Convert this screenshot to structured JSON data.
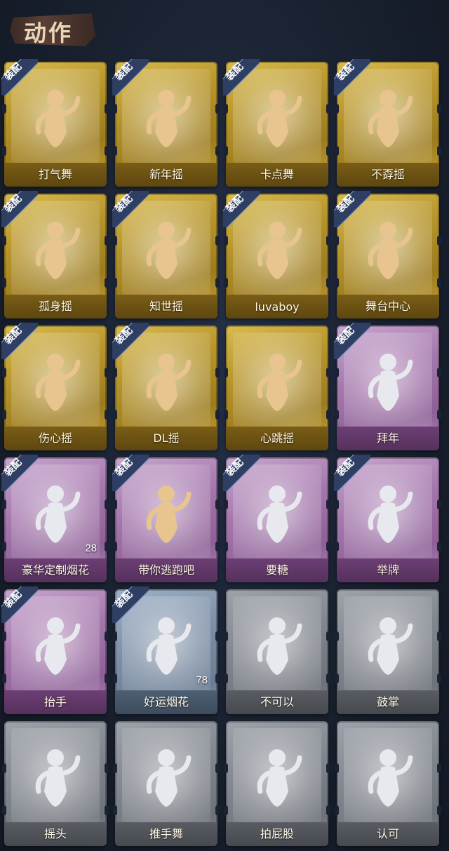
{
  "header": {
    "title": "动作"
  },
  "equip_label": "装配",
  "colors": {
    "gold": "#c9a73a",
    "purple": "#a578ad",
    "blue": "#7c8ea6",
    "gray": "#80858d",
    "figure_gold": "#e8c48f",
    "figure_white": "#e7e9ee"
  },
  "cards": [
    {
      "label": "打气舞",
      "tier": "gold",
      "equipped": true,
      "icon": "dance-pump-icon"
    },
    {
      "label": "新年摇",
      "tier": "gold",
      "equipped": true,
      "icon": "dance-newyear-icon"
    },
    {
      "label": "卡点舞",
      "tier": "gold",
      "equipped": true,
      "icon": "dance-beat-icon"
    },
    {
      "label": "不孬摇",
      "tier": "gold",
      "equipped": true,
      "icon": "dance-sway-icon"
    },
    {
      "label": "孤身摇",
      "tier": "gold",
      "equipped": true,
      "icon": "dance-solo-icon"
    },
    {
      "label": "知世摇",
      "tier": "gold",
      "equipped": true,
      "icon": "dance-wisdom-icon"
    },
    {
      "label": "luvaboy",
      "tier": "gold",
      "equipped": true,
      "icon": "dance-luvaboy-icon"
    },
    {
      "label": "舞台中心",
      "tier": "gold",
      "equipped": true,
      "icon": "dance-center-icon"
    },
    {
      "label": "伤心摇",
      "tier": "gold",
      "equipped": true,
      "icon": "heart-hands-icon"
    },
    {
      "label": "DL摇",
      "tier": "gold",
      "equipped": true,
      "icon": "dance-dl-icon"
    },
    {
      "label": "心跳摇",
      "tier": "gold",
      "equipped": false,
      "icon": "dance-heartbeat-icon"
    },
    {
      "label": "拜年",
      "tier": "purple",
      "equipped": true,
      "icon": "bow-greeting-icon"
    },
    {
      "label": "豪华定制烟花",
      "tier": "purple",
      "equipped": true,
      "icon": "fireworks-box-icon",
      "count": "28"
    },
    {
      "label": "带你逃跑吧",
      "tier": "purple",
      "equipped": true,
      "icon": "dance-run-icon"
    },
    {
      "label": "要糖",
      "tier": "purple",
      "equipped": true,
      "icon": "ask-candy-icon"
    },
    {
      "label": "举牌",
      "tier": "purple",
      "equipped": true,
      "icon": "hold-sign-icon"
    },
    {
      "label": "抬手",
      "tier": "purple",
      "equipped": true,
      "icon": "raise-hand-icon"
    },
    {
      "label": "好运烟花",
      "tier": "blue",
      "equipped": true,
      "icon": "firework-can-icon",
      "count": "78"
    },
    {
      "label": "不可以",
      "tier": "gray",
      "equipped": false,
      "icon": "finger-wag-icon"
    },
    {
      "label": "鼓掌",
      "tier": "gray",
      "equipped": false,
      "icon": "clap-icon"
    },
    {
      "label": "摇头",
      "tier": "gray",
      "equipped": false,
      "icon": "shake-head-icon"
    },
    {
      "label": "推手舞",
      "tier": "gray",
      "equipped": false,
      "icon": "push-dance-icon"
    },
    {
      "label": "拍屁股",
      "tier": "gray",
      "equipped": false,
      "icon": "pat-butt-icon"
    },
    {
      "label": "认可",
      "tier": "gray",
      "equipped": false,
      "icon": "thumbs-up-icon"
    }
  ]
}
